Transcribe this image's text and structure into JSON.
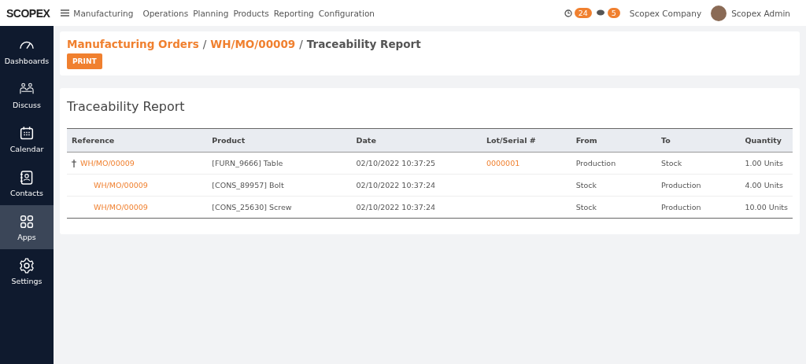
{
  "topbar": {
    "logo": "SCOPEX",
    "app": "Manufacturing",
    "menu": [
      "Operations",
      "Planning",
      "Products",
      "Reporting",
      "Configuration"
    ],
    "activity_count": "24",
    "message_count": "5",
    "company": "Scopex Company",
    "user": "Scopex Admin"
  },
  "sidebar": {
    "items": [
      {
        "label": "Dashboards",
        "selected": false
      },
      {
        "label": "Discuss",
        "selected": false
      },
      {
        "label": "Calendar",
        "selected": false
      },
      {
        "label": "Contacts",
        "selected": false
      },
      {
        "label": "Apps",
        "selected": true
      },
      {
        "label": "Settings",
        "selected": false
      }
    ]
  },
  "breadcrumb": {
    "parts": [
      "Manufacturing Orders",
      "WH/MO/00009",
      "Traceability Report"
    ],
    "separators": [
      "/",
      "/"
    ],
    "print_button": "PRINT"
  },
  "report": {
    "title": "Traceability Report",
    "columns": [
      "Reference",
      "Product",
      "Date",
      "Lot/Serial #",
      "From",
      "To",
      "Quantity"
    ],
    "rows": [
      {
        "reference": "WH/MO/00009",
        "product": "[FURN_9666] Table",
        "date": "02/10/2022 10:37:25",
        "lot": "0000001",
        "from": "Production",
        "to": "Stock",
        "quantity": "1.00 Units",
        "children": [
          {
            "reference": "WH/MO/00009",
            "product": "[CONS_89957] Bolt",
            "date": "02/10/2022 10:37:24",
            "from": "Stock",
            "to": "Production",
            "quantity": "4.00 Units"
          },
          {
            "reference": "WH/MO/00009",
            "product": "[CONS_25630] Screw",
            "date": "02/10/2022 10:37:24",
            "from": "Stock",
            "to": "Production",
            "quantity": "10.00 Units"
          }
        ]
      }
    ]
  }
}
